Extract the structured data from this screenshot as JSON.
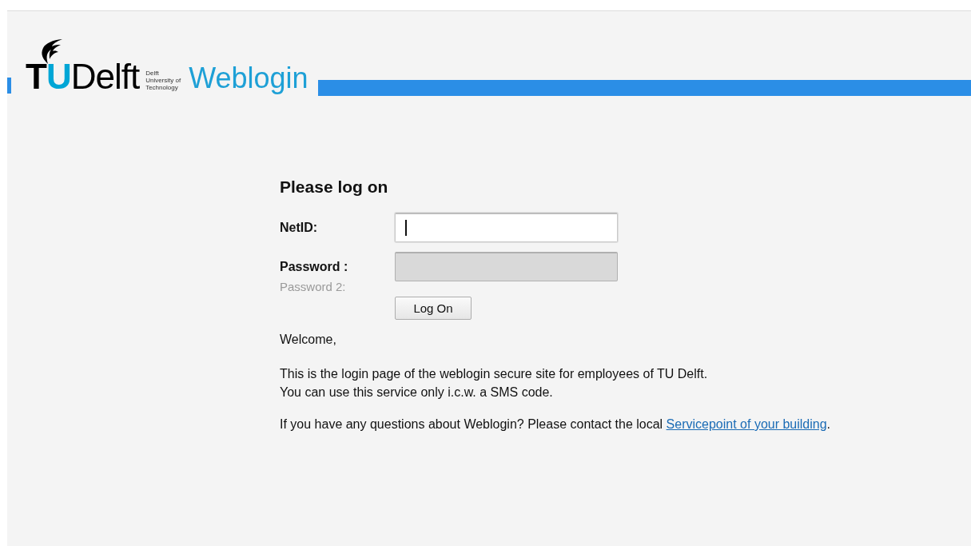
{
  "header": {
    "logo_letters": [
      {
        "text": "T",
        "color": "#000000"
      },
      {
        "text": "U",
        "color": "#00a6d6"
      },
      {
        "text": "Delft",
        "color": "#000000"
      }
    ],
    "university_lines": [
      "Delft",
      "University of",
      "Technology"
    ],
    "app_title": "Weblogin"
  },
  "form": {
    "title": "Please log on",
    "fields": [
      {
        "label": "NetID:",
        "focused": true,
        "disabled": false
      },
      {
        "label": "Password :",
        "focused": false,
        "disabled": true
      }
    ],
    "hidden_label": "Password 2:",
    "button": "Log On"
  },
  "message": {
    "greeting": "Welcome,",
    "lines": [
      "This is the login page of the weblogin secure site for employees of TU Delft.",
      "You can use this service only i.c.w. a SMS code."
    ],
    "contact_text": "If you have any questions about Weblogin? Please contact the local",
    "contact_link": "Servicepoint of your building",
    "contact_end": "."
  }
}
